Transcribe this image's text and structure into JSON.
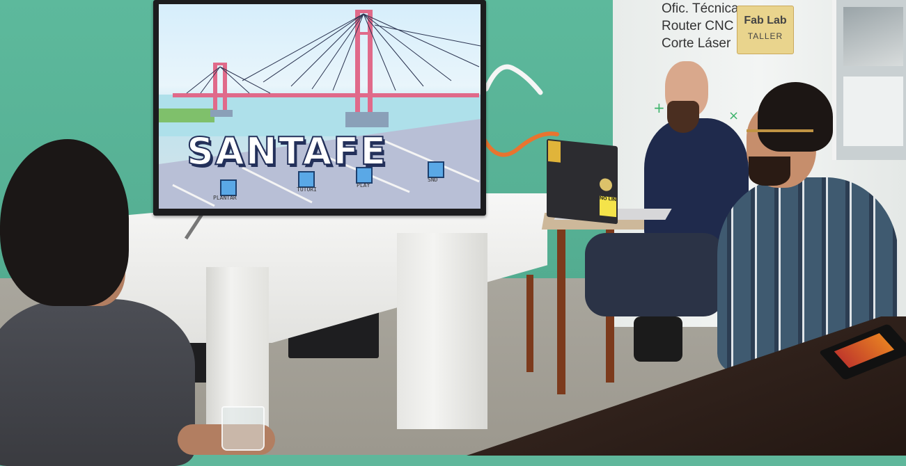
{
  "signage": {
    "line1": "Ofic. Técnica",
    "line2": "Router CNC",
    "line3": "Corte Láser",
    "badge_title": "Fab Lab",
    "badge_sub": "TALLER"
  },
  "tv_game": {
    "title": "SANTAFE",
    "menu": [
      {
        "label": "PLANTAR",
        "icon": "fullscreen-icon"
      },
      {
        "label": "TUTORI",
        "icon": "help-icon"
      },
      {
        "label": "PLAY",
        "icon": "play-icon"
      },
      {
        "label": "SND",
        "icon": "sound-icon"
      }
    ]
  },
  "laptop_sticker": "NO LIN",
  "colors": {
    "wall": "#5db99c",
    "bridge": "#e06a8a",
    "pedestal": "#f2f2f0",
    "desk_wood": "#7c3a1c"
  }
}
